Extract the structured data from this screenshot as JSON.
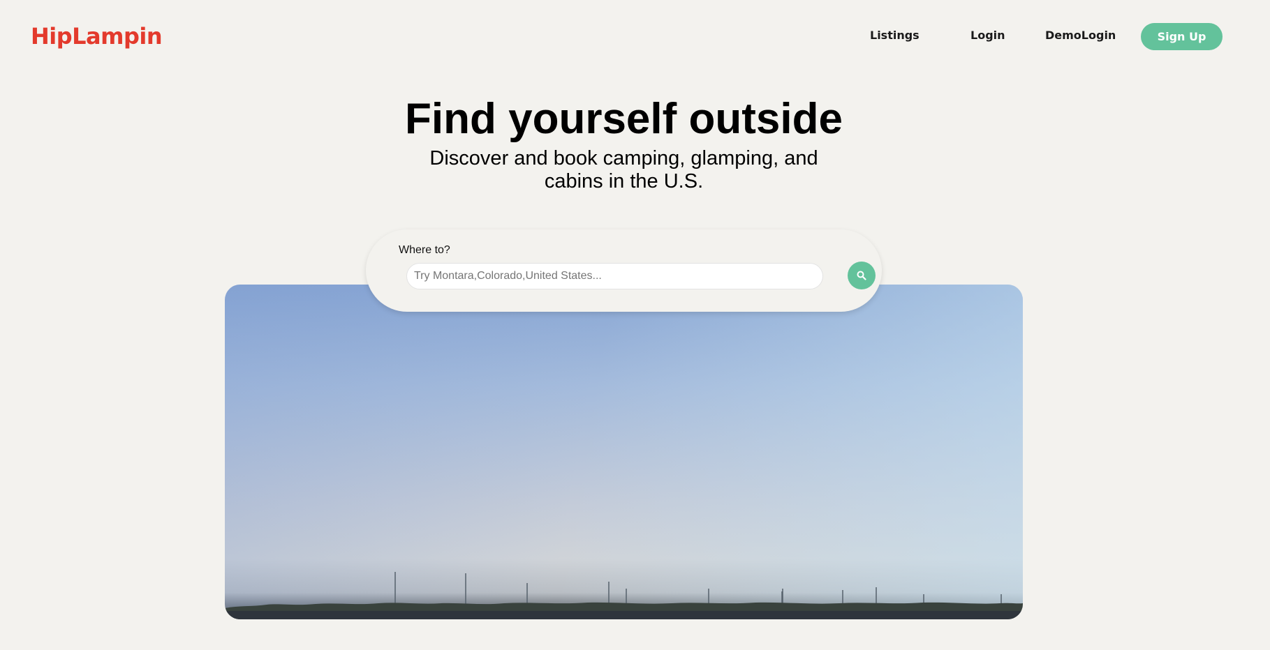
{
  "header": {
    "logo": "HipLampin",
    "nav": {
      "listings": "Listings",
      "login": "Login",
      "demo_login": "DemoLogin",
      "signup": "Sign Up"
    }
  },
  "hero": {
    "title": "Find yourself outside",
    "subtitle": "Discover and book camping, glamping, and cabins in the U.S."
  },
  "search": {
    "label": "Where to?",
    "placeholder": "Try Montara,Colorado,United States...",
    "value": "",
    "button_icon": "search-icon"
  },
  "colors": {
    "brand": "#e33a2c",
    "accent": "#63c29b",
    "background": "#f3f2ee"
  }
}
